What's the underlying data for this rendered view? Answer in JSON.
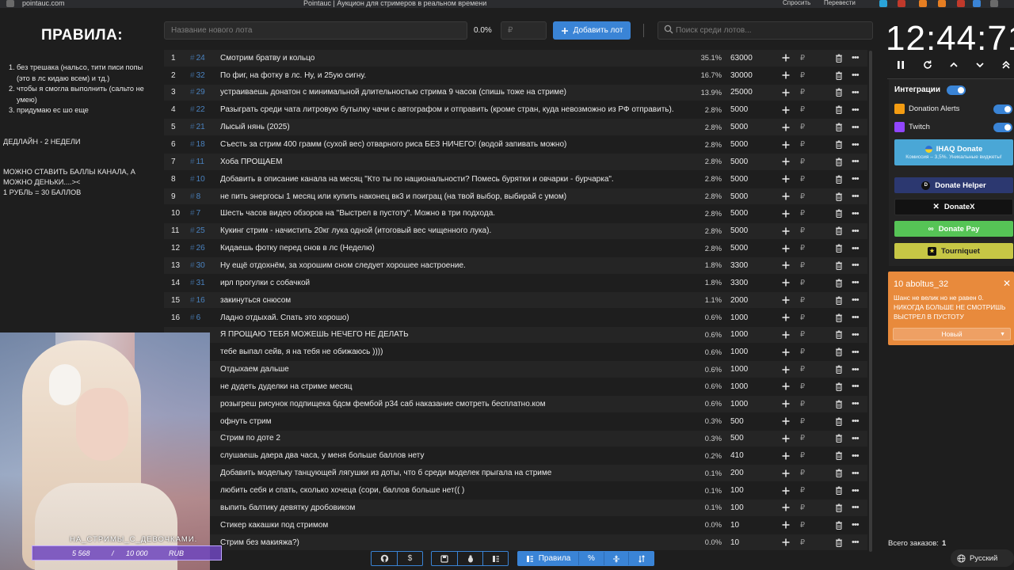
{
  "browser": {
    "url": "pointauc.com",
    "title": "Pointauc | Аукцион для стримеров в реальном времени",
    "ask": "Спросить",
    "translate": "Перевести"
  },
  "rules": {
    "title": "ПРАВИЛА:",
    "items": [
      {
        "num": "1.",
        "text": "без трешака (нальсо, тити писи попы (это в лс кидаю всем) и тд.)"
      },
      {
        "num": "2.",
        "text": "чтобы я смогла выполнить (сальто не умею)"
      },
      {
        "num": "3.",
        "text": "придумаю ес шо еще"
      }
    ],
    "deadline": "ДЕДЛАЙН - 2 НЕДЕЛИ",
    "points_line1": "МОЖНО СТАВИТЬ БАЛЛЫ КАНАЛА, А МОЖНО ДЕНЬКИ....><",
    "points_line2": "1 РУБЛЬ = 30 БАЛЛОВ"
  },
  "controls": {
    "lot_placeholder": "Название нового лота",
    "percent": "0.0%",
    "amount_placeholder": "₽",
    "add_label": "Добавить лот",
    "search_placeholder": "Поиск среди лотов..."
  },
  "lots": [
    {
      "n": "1",
      "id": "24",
      "name": "Смотрим братву и кольцо",
      "pct": "35.1%",
      "amount": "63000"
    },
    {
      "n": "2",
      "id": "32",
      "name": "По фиг, на фотку в лс. Ну, и 25ую сигну.",
      "pct": "16.7%",
      "amount": "30000"
    },
    {
      "n": "3",
      "id": "29",
      "name": "устраиваешь донатон с минимальной длительностью стрима 9 часов (спишь тоже на стриме)",
      "pct": "13.9%",
      "amount": "25000"
    },
    {
      "n": "4",
      "id": "22",
      "name": "Разыграть среди чата литровую бутылку чачи с автографом и отправить (кроме стран, куда невозможно из РФ отправить).",
      "pct": "2.8%",
      "amount": "5000"
    },
    {
      "n": "5",
      "id": "21",
      "name": "Лысый нянь (2025)",
      "pct": "2.8%",
      "amount": "5000"
    },
    {
      "n": "6",
      "id": "18",
      "name": "Съесть за стрим 400 грамм (сухой вес) отварного риса БЕЗ НИЧЕГО! (водой запивать можно)",
      "pct": "2.8%",
      "amount": "5000"
    },
    {
      "n": "7",
      "id": "11",
      "name": "Хоба ПРОЩАЕМ",
      "pct": "2.8%",
      "amount": "5000"
    },
    {
      "n": "8",
      "id": "10",
      "name": "Добавить в описание канала на месяц \"Кто ты по национальности? Помесь бурятки и овчарки - бурчарка\".",
      "pct": "2.8%",
      "amount": "5000"
    },
    {
      "n": "9",
      "id": "8",
      "name": "не пить энергосы 1 месяц или купить наконец вк3 и поиграц (на твой выбор, выбирай с умом)",
      "pct": "2.8%",
      "amount": "5000"
    },
    {
      "n": "10",
      "id": "7",
      "name": "Шесть часов видео обзоров на \"Выстрел в пустоту\". Можно в три подхода.",
      "pct": "2.8%",
      "amount": "5000"
    },
    {
      "n": "11",
      "id": "25",
      "name": "Кукинг стрим - начистить 20кг лука одной (итоговый вес чищенного лука).",
      "pct": "2.8%",
      "amount": "5000"
    },
    {
      "n": "12",
      "id": "26",
      "name": "Кидаешь фотку перед снов в лс (Неделю)",
      "pct": "2.8%",
      "amount": "5000"
    },
    {
      "n": "13",
      "id": "30",
      "name": "Ну ещё отдохнём, за хорошим сном следует хорошее настроение.",
      "pct": "1.8%",
      "amount": "3300"
    },
    {
      "n": "14",
      "id": "31",
      "name": "ирл прогулки с собачкой",
      "pct": "1.8%",
      "amount": "3300"
    },
    {
      "n": "15",
      "id": "16",
      "name": "закинуться снюсом",
      "pct": "1.1%",
      "amount": "2000"
    },
    {
      "n": "16",
      "id": "6",
      "name": "Ладно отдыхай. Спать это хорошо)",
      "pct": "0.6%",
      "amount": "1000"
    },
    {
      "n": "",
      "id": "",
      "name": "Я ПРОЩАЮ ТЕБЯ МОЖЕШЬ НЕЧЕГО НЕ ДЕЛАТЬ",
      "pct": "0.6%",
      "amount": "1000"
    },
    {
      "n": "",
      "id": "",
      "name": "тебе выпал сейв, я на тебя не обижаюсь ))))",
      "pct": "0.6%",
      "amount": "1000"
    },
    {
      "n": "",
      "id": "",
      "name": "Отдыхаем дальше",
      "pct": "0.6%",
      "amount": "1000"
    },
    {
      "n": "",
      "id": "",
      "name": "не дудеть дуделки на стриме месяц",
      "pct": "0.6%",
      "amount": "1000"
    },
    {
      "n": "",
      "id": "",
      "name": "розыгреш рисунок подпищека бдсм фембой р34 саб наказание смотреть бесплатно.ком",
      "pct": "0.6%",
      "amount": "1000"
    },
    {
      "n": "",
      "id": "",
      "name": "офнуть стрим",
      "pct": "0.3%",
      "amount": "500"
    },
    {
      "n": "",
      "id": "",
      "name": "Стрим по доте 2",
      "pct": "0.3%",
      "amount": "500"
    },
    {
      "n": "",
      "id": "",
      "name": "слушаешь даера два часа, у меня больше баллов нету",
      "pct": "0.2%",
      "amount": "410"
    },
    {
      "n": "",
      "id": "",
      "name": "Добавить модельку танцующей лягушки из доты, что б среди моделек прыгала на стриме",
      "pct": "0.1%",
      "amount": "200"
    },
    {
      "n": "",
      "id": "",
      "name": "любить себя и спать, сколько хочеца (сори, баллов больше нет(( )",
      "pct": "0.1%",
      "amount": "100"
    },
    {
      "n": "",
      "id": "",
      "name": "выпить балтику девятку дробовиком",
      "pct": "0.1%",
      "amount": "100"
    },
    {
      "n": "",
      "id": "",
      "name": "Стикер какашки под стримом",
      "pct": "0.0%",
      "amount": "10"
    },
    {
      "n": "",
      "id": "",
      "name": "Стрим без макияжа?)",
      "pct": "0.0%",
      "amount": "10"
    }
  ],
  "currency": "₽",
  "toolbar": {
    "rules_label": "Правила"
  },
  "timer": "12:44:71",
  "integrations": {
    "title": "Интеграции",
    "donation_alerts": "Donation Alerts",
    "twitch": "Twitch",
    "ihaq": "IHAQ Donate",
    "ihaq_sub": "Комиссия – 3,5%. Уникальные виджеты!",
    "donate_helper": "Donate Helper",
    "donatex": "DonateX",
    "donate_pay": "Donate Pay",
    "tourniquet": "Tourniquet"
  },
  "notification": {
    "title": "10 aboltus_32",
    "message": "Шанс не велик но не равен 0. НИКОГДА БОЛЬШЕ НЕ СМОТРИШЬ ВЫСТРЕЛ В ПУСТОТУ",
    "select_value": "Новый"
  },
  "orders": {
    "label": "Всего заказов:",
    "count": "1"
  },
  "language": "Русский",
  "webcam": {
    "caption": "НА_СТРИМЫ_С_ДЕВОЧКАМИ.",
    "goal_current": "5 568",
    "goal_sep": "/",
    "goal_target": "10 000",
    "goal_currency": "RUB"
  },
  "colors": {
    "accent": "#3a84d6",
    "notification": "#e88a3c",
    "donate_pay": "#56c456",
    "tourniquet": "#c7c745"
  }
}
